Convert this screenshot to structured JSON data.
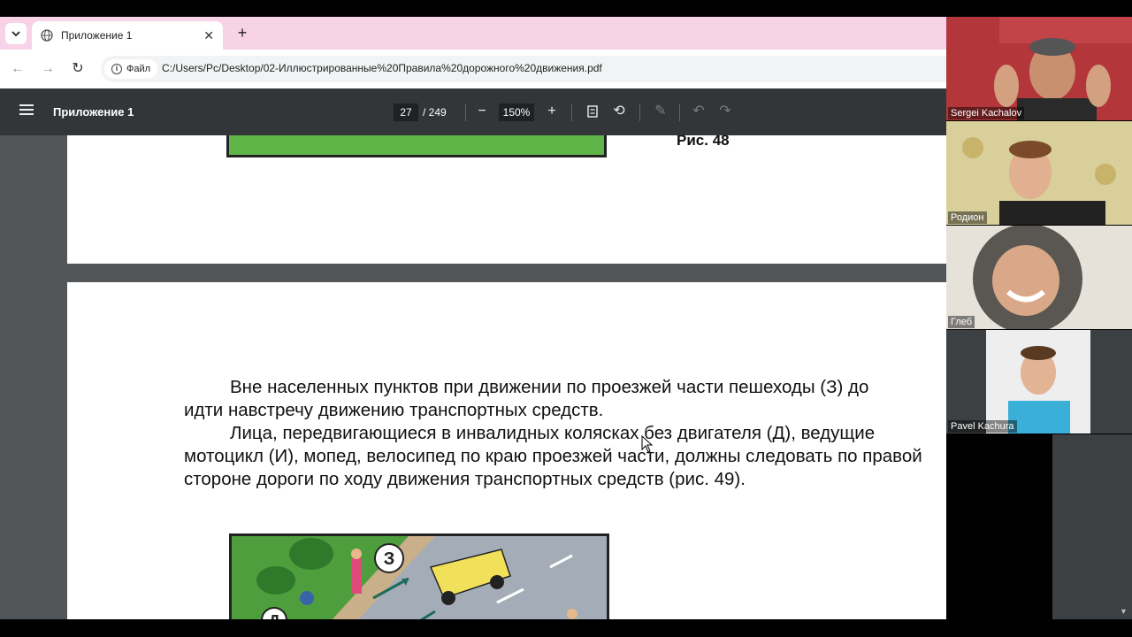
{
  "browser": {
    "tab_title": "Приложение 1",
    "chip_label": "Файл",
    "url": "C:/Users/Pc/Desktop/02-Иллюстрированные%20Правила%20дорожного%20движения.pdf"
  },
  "pdf_toolbar": {
    "title": "Приложение 1",
    "page_current": "27",
    "page_total": "/ 249",
    "zoom": "150%"
  },
  "document": {
    "figure_48_caption": "Рис. 48",
    "paragraph_1_line_1": "Вне населенных пунктов при движении по проезжей части пешеходы (З) до",
    "paragraph_1_line_2": "идти навстречу движению транспортных средств.",
    "paragraph_2_line_1": "Лица, передвигающиеся в инвалидных колясках без двигателя (Д), ведущие",
    "paragraph_2_line_2": "мотоцикл (И), мопед, велосипед по краю проезжей части, должны следовать по правой",
    "paragraph_2_line_3": "стороне дороги по ходу движения транспортных средств (рис. 49).",
    "figure_49_label_z": "З",
    "figure_49_label_d": "Д"
  },
  "participants": [
    {
      "name": "Sergei Kachalov"
    },
    {
      "name": "Родион"
    },
    {
      "name": "Глеб"
    },
    {
      "name": "Pavel Kachura"
    }
  ],
  "colors": {
    "tabstrip": "#f8d3e7",
    "pdf_toolbar": "#323639",
    "viewer_bg": "#525659",
    "figure_grass": "#5fb548",
    "car_yellow": "#f1e05a"
  }
}
